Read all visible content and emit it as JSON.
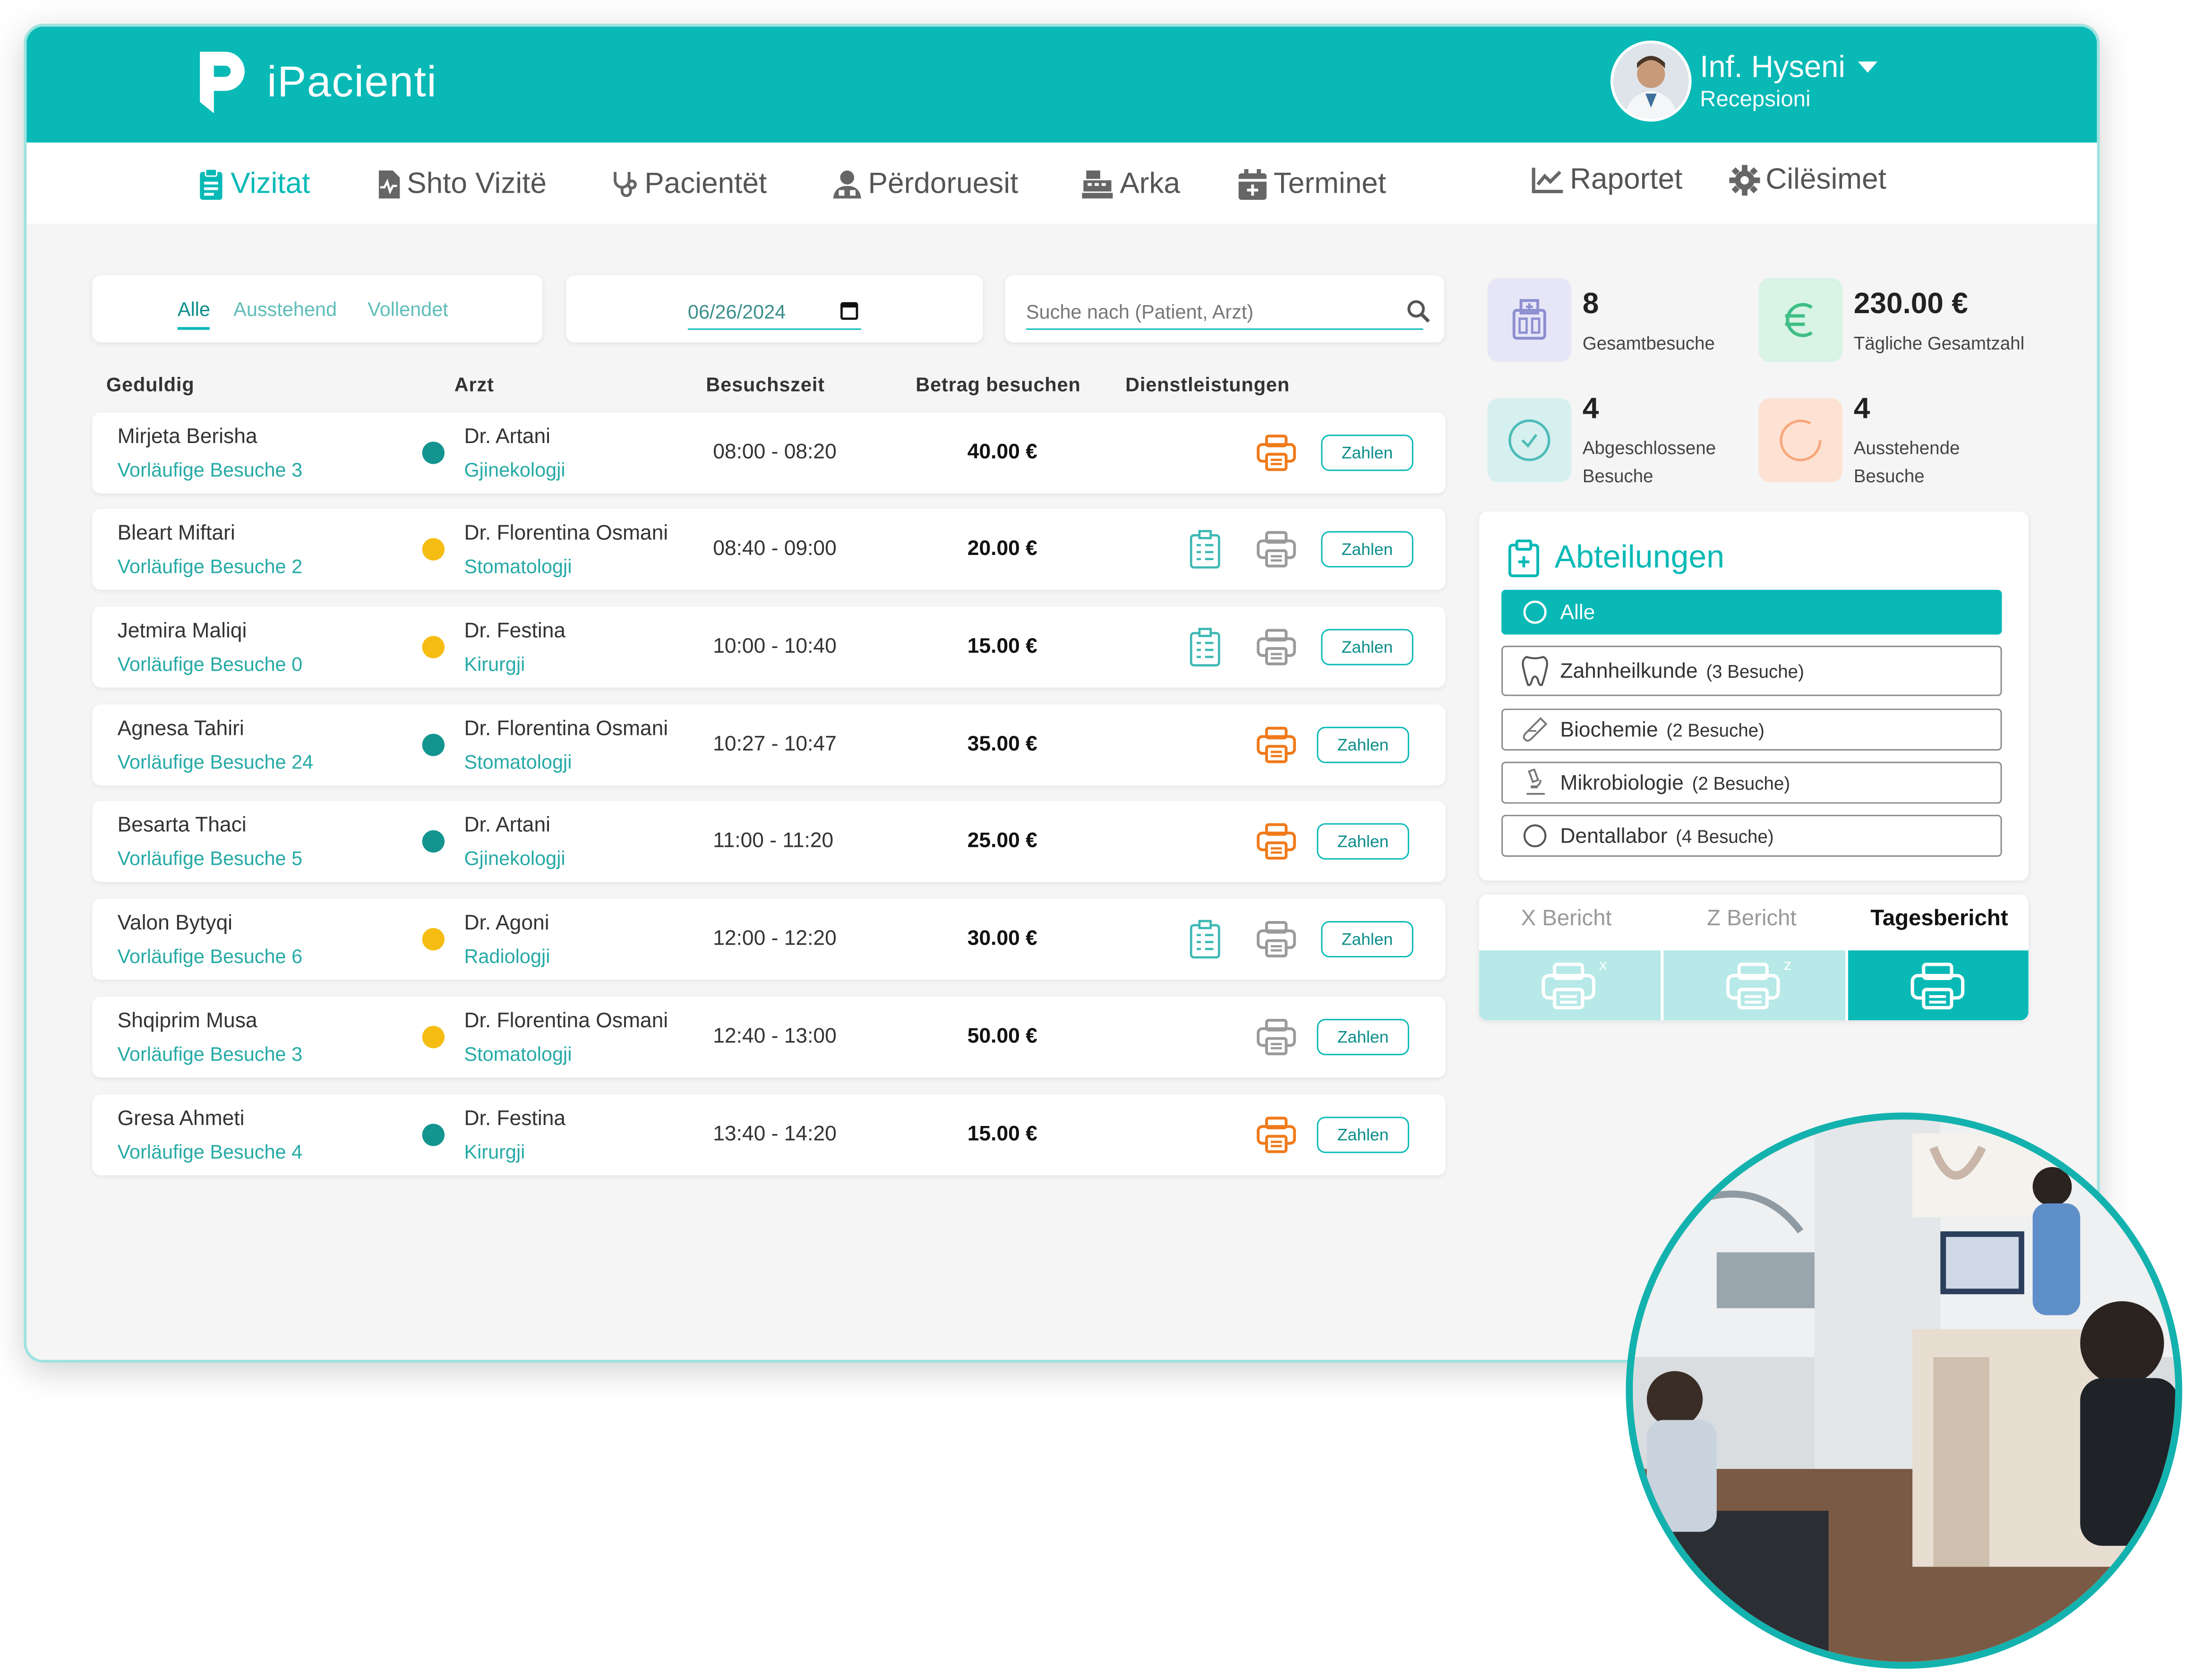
{
  "app": {
    "brand": "iPacienti"
  },
  "user": {
    "name": "Inf. Hyseni",
    "role": "Recepsioni"
  },
  "nav": {
    "items": [
      {
        "label": "Vizitat",
        "icon": "clipboard-icon",
        "active": true
      },
      {
        "label": "Shto Vizitë",
        "icon": "file-pulse-icon"
      },
      {
        "label": "Pacientët",
        "icon": "stethoscope-icon"
      },
      {
        "label": "Përdoruesit",
        "icon": "users-icon"
      },
      {
        "label": "Arka",
        "icon": "cash-register-icon"
      },
      {
        "label": "Terminet",
        "icon": "calendar-plus-icon"
      },
      {
        "label": "Raportet",
        "icon": "chart-line-icon"
      },
      {
        "label": "Cilësimet",
        "icon": "gear-icon"
      }
    ]
  },
  "filters": {
    "tabs": [
      "Alle",
      "Ausstehend",
      "Vollendet"
    ],
    "active_tab": "Alle",
    "date": "06/26/2024",
    "search_placeholder": "Suche nach (Patient, Arzt)"
  },
  "table": {
    "headers": [
      "Geduldig",
      "Arzt",
      "Besuchszeit",
      "Betrag besuchen",
      "Dienstleistungen"
    ],
    "pay_label": "Zahlen",
    "rows": [
      {
        "patient": "Mirjeta Berisha",
        "prev": "Vorläufige Besuche 3",
        "status": "#13948f",
        "doctor": "Dr. Artani",
        "dept": "Gjinekologji",
        "time": "08:00 - 08:20",
        "amount": "40.00 €"
      },
      {
        "patient": "Bleart Miftari",
        "prev": "Vorläufige Besuche 2",
        "status": "#f5bd12",
        "doctor": "Dr. Florentina Osmani",
        "dept": "Stomatologji",
        "time": "08:40 - 09:00",
        "amount": "20.00 €"
      },
      {
        "patient": "Jetmira Maliqi",
        "prev": "Vorläufige Besuche 0",
        "status": "#f5bd12",
        "doctor": "Dr. Festina",
        "dept": "Kirurgji",
        "time": "10:00 - 10:40",
        "amount": "15.00 €"
      },
      {
        "patient": "Agnesa Tahiri",
        "prev": "Vorläufige Besuche 24",
        "status": "#13948f",
        "doctor": "Dr. Florentina Osmani",
        "dept": "Stomatologji",
        "time": "10:27 - 10:47",
        "amount": "35.00 €"
      },
      {
        "patient": "Besarta Thaci",
        "prev": "Vorläufige Besuche 5",
        "status": "#13948f",
        "doctor": "Dr. Artani",
        "dept": "Gjinekologji",
        "time": "11:00 - 11:20",
        "amount": "25.00 €"
      },
      {
        "patient": "Valon Bytyqi",
        "prev": "Vorläufige Besuche 6",
        "status": "#f5bd12",
        "doctor": "Dr. Agoni",
        "dept": "Radiologji",
        "time": "12:00 - 12:20",
        "amount": "30.00 €"
      },
      {
        "patient": "Shqiprim Musa",
        "prev": "Vorläufige Besuche 3",
        "status": "#f5bd12",
        "doctor": "Dr. Florentina Osmani",
        "dept": "Stomatologji",
        "time": "12:40 - 13:00",
        "amount": "50.00 €"
      },
      {
        "patient": "Gresa Ahmeti",
        "prev": "Vorläufige Besuche 4",
        "status": "#13948f",
        "doctor": "Dr. Festina",
        "dept": "Kirurgji",
        "time": "13:40 - 14:20",
        "amount": "15.00 €"
      }
    ]
  },
  "stats": {
    "total": {
      "value": "8",
      "label": "Gesamtbesuche"
    },
    "daily": {
      "value": "230.00 €",
      "label": "Tägliche Gesamtzahl"
    },
    "completed": {
      "value": "4",
      "label_1": "Abgeschlossene",
      "label_2": "Besuche"
    },
    "pending": {
      "value": "4",
      "label_1": "Ausstehende",
      "label_2": "Besuche"
    }
  },
  "departments": {
    "title": "Abteilungen",
    "items": [
      {
        "label": "Alle",
        "count": ""
      },
      {
        "label": "Zahnheilkunde",
        "count": "(3 Besuche)"
      },
      {
        "label": "Biochemie",
        "count": "(2 Besuche)"
      },
      {
        "label": "Mikrobiologie",
        "count": "(2 Besuche)"
      },
      {
        "label": "Dentallabor",
        "count": "(4 Besuche)"
      }
    ]
  },
  "reports": {
    "tabs": [
      "X Bericht",
      "Z Bericht",
      "Tagesbericht"
    ],
    "active": "Tagesbericht",
    "badges": [
      "x",
      "z"
    ]
  },
  "colors": {
    "accent": "#08b9b6",
    "status_done": "#13948f",
    "status_pending": "#f5bd12",
    "print_active": "#f07a1a"
  }
}
